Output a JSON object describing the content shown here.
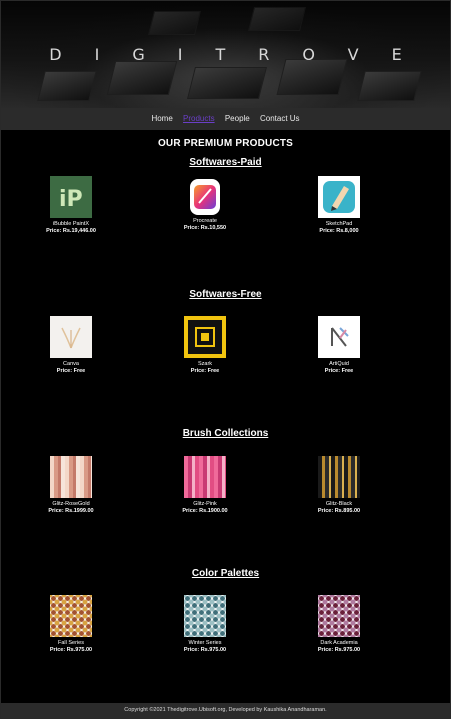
{
  "banner": {
    "title": "DIGITROVE"
  },
  "nav": {
    "items": [
      {
        "label": "Home"
      },
      {
        "label": "Products"
      },
      {
        "label": "People"
      },
      {
        "label": "Contact Us"
      }
    ]
  },
  "main": {
    "title": "OUR PREMIUM PRODUCTS",
    "sections": [
      {
        "title": "Softwares-Paid",
        "products": [
          {
            "name": "iBubble PaintX",
            "price": "Price: Rs.19,446.00",
            "icon": "paint-app-icon"
          },
          {
            "name": "Procreate",
            "price": "Price: Rs.10,550",
            "icon": "procreate-icon"
          },
          {
            "name": "SketchPad",
            "price": "Price: Rs.8,000",
            "icon": "sketchpad-icon"
          }
        ]
      },
      {
        "title": "Softwares-Free",
        "products": [
          {
            "name": "Canva",
            "price": "Price: Free",
            "icon": "canva-icon"
          },
          {
            "name": "Szark",
            "price": "Price: Free",
            "icon": "szark-icon"
          },
          {
            "name": "ArtiQuid",
            "price": "Price: Free",
            "icon": "artiquid-icon"
          }
        ]
      },
      {
        "title": "Brush Collections",
        "products": [
          {
            "name": "Glitz-RoseGold",
            "price": "Price: Rs.1999.00",
            "icon": "brush-rosegold-swatch"
          },
          {
            "name": "Glitz-Pink",
            "price": "Price: Rs.1900.00",
            "icon": "brush-pink-swatch"
          },
          {
            "name": "Glitz-Black",
            "price": "Price: Rs.895.00",
            "icon": "brush-black-swatch"
          }
        ]
      },
      {
        "title": "Color Palettes",
        "products": [
          {
            "name": "Fall Series",
            "price": "Price: Rs.975.00",
            "icon": "palette-fall-swatch"
          },
          {
            "name": "Winter Series",
            "price": "Price: Rs.975.00",
            "icon": "palette-winter-swatch"
          },
          {
            "name": "Dark Academia",
            "price": "Price: Rs.975.00",
            "icon": "palette-dark-swatch"
          }
        ]
      }
    ]
  },
  "footer": {
    "text": "Copyright ©2021 Thedigitrove.Ubisoft.org, Developed by Kaushika Anandharaman."
  },
  "colors": {
    "nav_active": "#6a3fc7",
    "nav_bg": "#2b2b2b",
    "page_bg": "#000000"
  }
}
